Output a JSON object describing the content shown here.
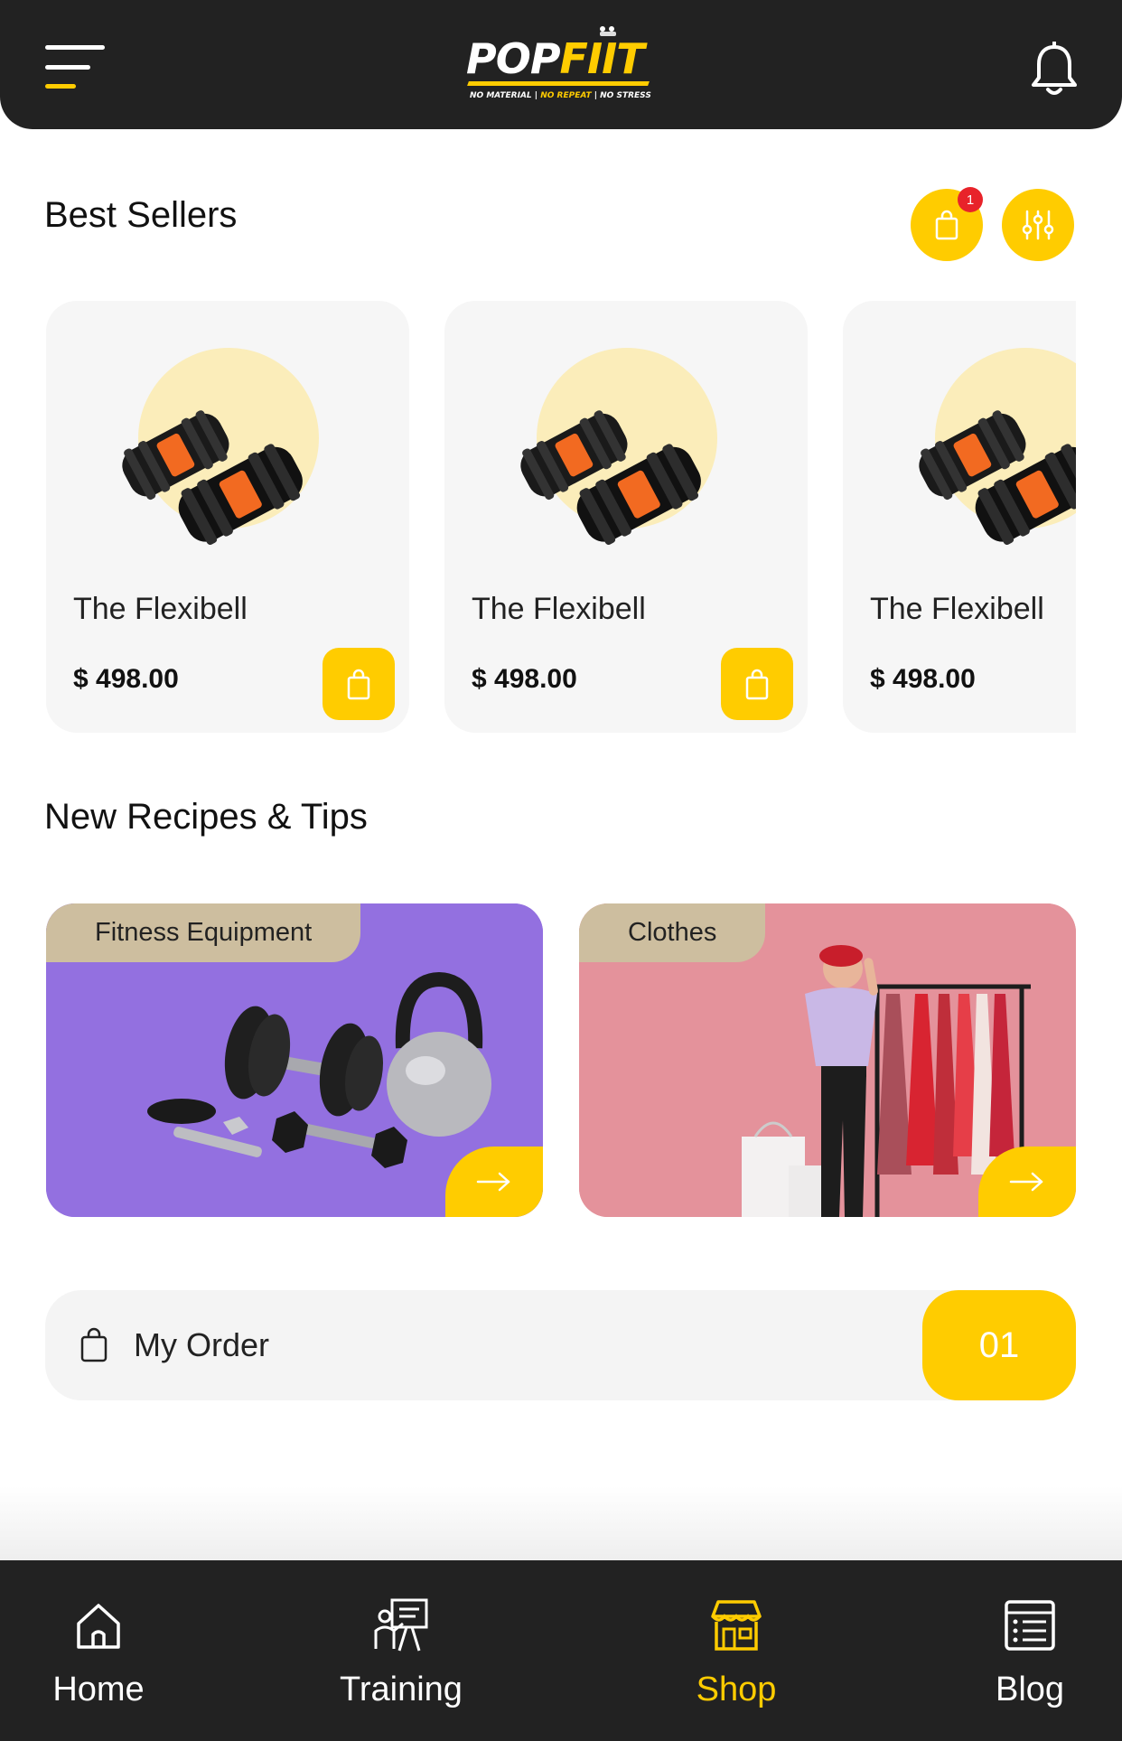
{
  "header": {
    "logo_part1": "POP",
    "logo_part2": "FIIT",
    "tagline_1": "NO MATERIAL | ",
    "tagline_2": "NO REPEAT",
    "tagline_3": " | NO STRESS",
    "menu_icon": "menu-icon",
    "notification_icon": "bell-icon"
  },
  "best_sellers": {
    "title": "Best Sellers",
    "cart_badge": "1",
    "products": [
      {
        "name": "The Flexibell",
        "price": "$ 498.00"
      },
      {
        "name": "The Flexibell",
        "price": "$ 498.00"
      },
      {
        "name": "The Flexibell",
        "price": "$ 498.00"
      }
    ]
  },
  "recipes": {
    "title": "New Recipes & Tips",
    "categories": [
      {
        "label": "Fitness Equipment",
        "background": "#9370E0"
      },
      {
        "label": "Clothes",
        "background": "#E4929B"
      }
    ]
  },
  "order": {
    "label": "My Order",
    "count": "01"
  },
  "bottom_nav": {
    "items": [
      {
        "label": "Home",
        "icon": "home-icon",
        "active": false
      },
      {
        "label": "Training",
        "icon": "training-icon",
        "active": false
      },
      {
        "label": "Shop",
        "icon": "shop-icon",
        "active": true
      },
      {
        "label": "Blog",
        "icon": "blog-icon",
        "active": false
      }
    ]
  },
  "colors": {
    "accent": "#FFCC00",
    "dark": "#222222",
    "badge": "#E8232A",
    "tag": "#CDBE9F"
  }
}
